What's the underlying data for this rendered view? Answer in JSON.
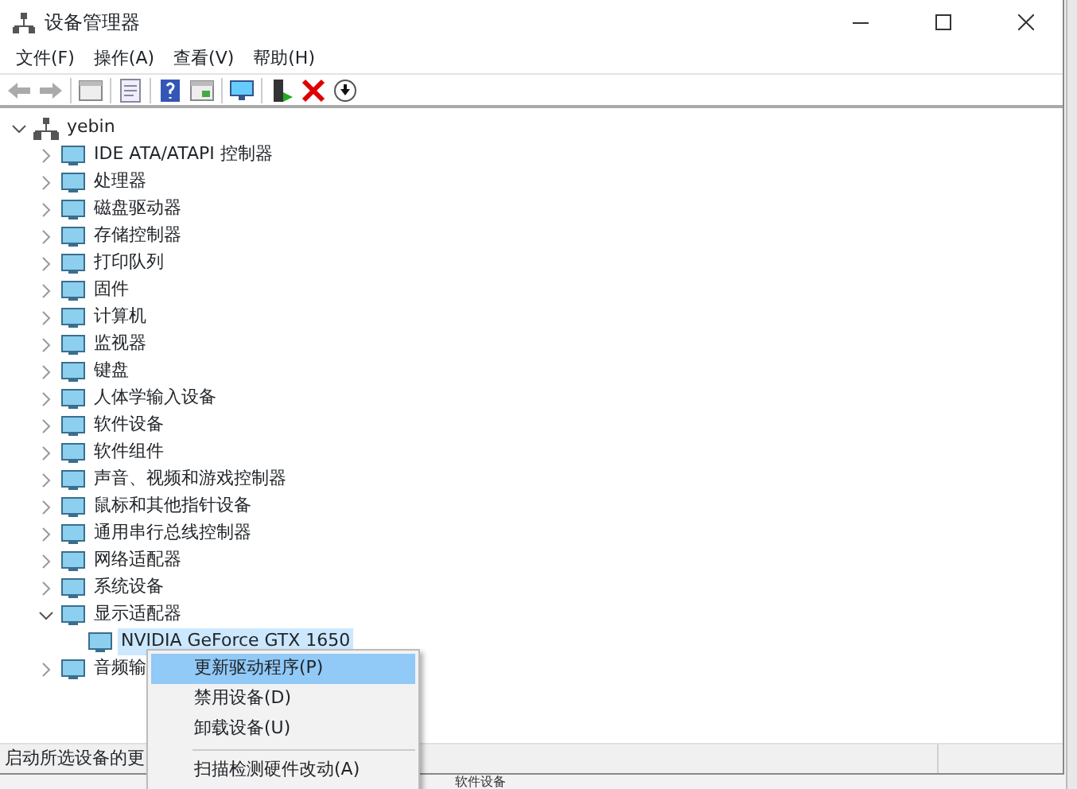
{
  "window": {
    "title": "设备管理器"
  },
  "menu": [
    "文件(F)",
    "操作(A)",
    "查看(V)",
    "帮助(H)"
  ],
  "tree": [
    {
      "label": "yebin",
      "expanded": true,
      "selected": false,
      "children": [
        {
          "label": "IDE ATA/ATAPI 控制器",
          "expanded": false,
          "selected": false
        },
        {
          "label": "处理器",
          "expanded": false,
          "selected": false
        },
        {
          "label": "磁盘驱动器",
          "expanded": false,
          "selected": false
        },
        {
          "label": "存储控制器",
          "expanded": false,
          "selected": false
        },
        {
          "label": "打印队列",
          "expanded": false,
          "selected": false
        },
        {
          "label": "固件",
          "expanded": false,
          "selected": false
        },
        {
          "label": "计算机",
          "expanded": false,
          "selected": false
        },
        {
          "label": "监视器",
          "expanded": false,
          "selected": false
        },
        {
          "label": "键盘",
          "expanded": false,
          "selected": false
        },
        {
          "label": "人体学输入设备",
          "expanded": false,
          "selected": false
        },
        {
          "label": "软件设备",
          "expanded": false,
          "selected": false
        },
        {
          "label": "软件组件",
          "expanded": false,
          "selected": false
        },
        {
          "label": "声音、视频和游戏控制器",
          "expanded": false,
          "selected": false
        },
        {
          "label": "鼠标和其他指针设备",
          "expanded": false,
          "selected": false
        },
        {
          "label": "通用串行总线控制器",
          "expanded": false,
          "selected": false
        },
        {
          "label": "网络适配器",
          "expanded": false,
          "selected": false
        },
        {
          "label": "系统设备",
          "expanded": false,
          "selected": false
        },
        {
          "label": "显示适配器",
          "expanded": true,
          "selected": false,
          "children": [
            {
              "label": "NVIDIA GeForce GTX 1650",
              "selected": true
            }
          ]
        },
        {
          "label": "音频输",
          "expanded": false,
          "selected": false
        }
      ]
    }
  ],
  "status_bar": "启动所选设备的更",
  "context_menu": [
    {
      "label": "更新驱动程序(P)",
      "selected": true
    },
    {
      "label": "禁用设备(D)",
      "selected": false
    },
    {
      "label": "卸载设备(U)",
      "selected": false
    },
    {
      "label": "扫描检测硬件改动(A)",
      "selected": false,
      "separator_before": true
    }
  ],
  "background_text": "软件设备"
}
